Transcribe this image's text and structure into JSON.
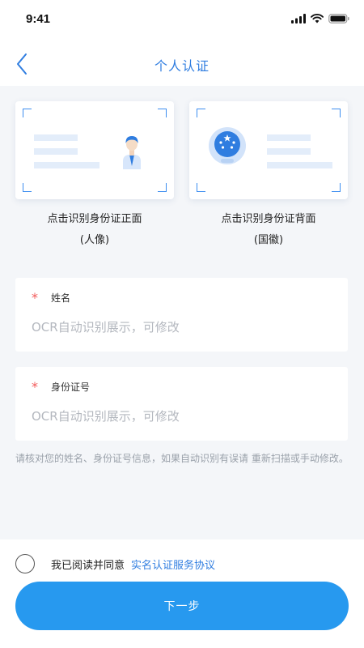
{
  "status_bar": {
    "time": "9:41"
  },
  "nav": {
    "title": "个人认证"
  },
  "id_cards": {
    "front": {
      "caption_line1": "点击识别身份证正面",
      "caption_line2": "(人像)"
    },
    "back": {
      "caption_line1": "点击识别身份证背面",
      "caption_line2": "(国徽)"
    }
  },
  "form": {
    "required_mark": "*",
    "name": {
      "label": "姓名",
      "placeholder": "OCR自动识别展示，可修改",
      "value": ""
    },
    "id_number": {
      "label": "身份证号",
      "placeholder": "OCR自动识别展示，可修改",
      "value": ""
    }
  },
  "hint": "请核对您的姓名、身份证号信息，如果自动识别有误请 重新扫描或手动修改。",
  "agreement": {
    "text": "我已阅读并同意",
    "link": "实名认证服务协议",
    "checked": false
  },
  "next_button": {
    "label": "下一步"
  },
  "colors": {
    "accent": "#2f7de0",
    "button": "#2799ef",
    "required": "#f25a5a",
    "hint": "#9aa1aa"
  }
}
